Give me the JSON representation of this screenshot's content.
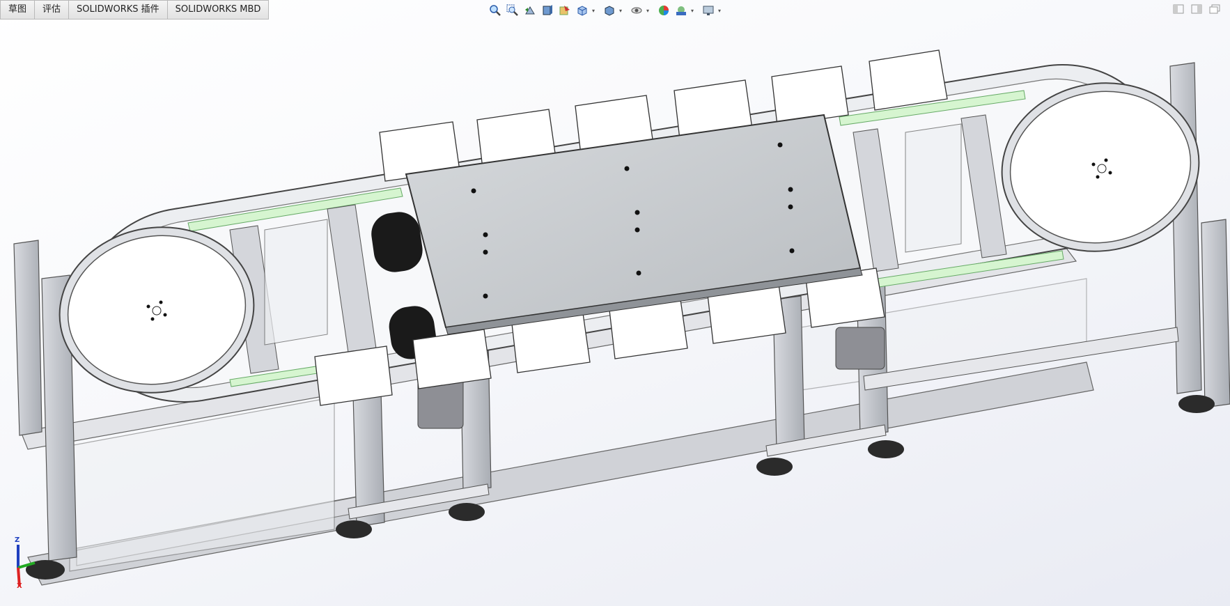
{
  "command_tabs": [
    {
      "label": "草图"
    },
    {
      "label": "评估"
    },
    {
      "label": "SOLIDWORKS 插件"
    },
    {
      "label": "SOLIDWORKS MBD"
    }
  ],
  "heads_up_toolbar": {
    "icons": [
      "zoom-to-fit-icon",
      "zoom-to-area-icon",
      "previous-view-icon",
      "section-view-icon",
      "dynamic-annotation-icon",
      "view-orientation-icon",
      "display-style-icon",
      "hide-show-items-icon",
      "edit-appearance-icon",
      "apply-scene-icon",
      "view-settings-icon"
    ]
  },
  "window_controls": [
    "tile-left-icon",
    "tile-right-icon",
    "restore-icon"
  ],
  "triad": {
    "z": "Z",
    "x": "X"
  },
  "colors": {
    "frame_silver": "#c9ccd3",
    "plate_white": "#ffffff",
    "table_top": "#c7cacd",
    "belt_green": "#d6f5d0",
    "motor_black": "#1a1a1a",
    "axis_red": "#d22",
    "axis_green": "#2a2",
    "axis_blue": "#1f3fbf"
  }
}
